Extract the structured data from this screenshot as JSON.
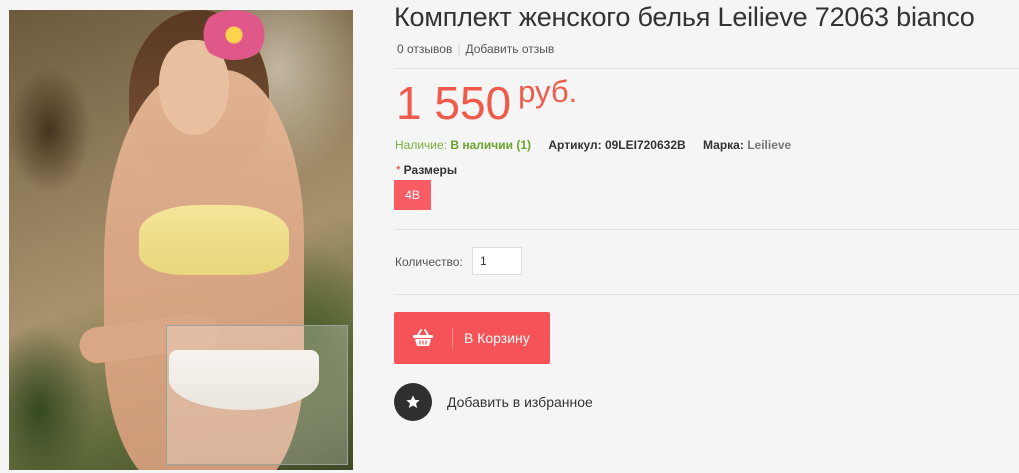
{
  "product": {
    "title": "Комплект женского белья Leilieve 72063 bianco",
    "image_alt": "product-photo"
  },
  "reviews": {
    "count_text": "0 отзывов",
    "add_text": "Добавить отзыв"
  },
  "price": {
    "amount": "1 550",
    "currency": "руб."
  },
  "meta": {
    "availability_label": "Наличие:",
    "availability_value": "В наличии (1)",
    "sku_label": "Артикул:",
    "sku_value": "09LEI720632B",
    "brand_label": "Марка:",
    "brand_value": "Leilieve"
  },
  "sizes": {
    "required_mark": "*",
    "label": "Размеры",
    "options": [
      "4B"
    ]
  },
  "quantity": {
    "label": "Количество:",
    "value": "1"
  },
  "cart": {
    "label": "В Корзину"
  },
  "wishlist": {
    "label": "Добавить в избранное"
  },
  "colors": {
    "accent": "#f55357",
    "price": "#ef5a4a",
    "in_stock": "#6aa32c"
  },
  "icons": {
    "cart": "basket-icon",
    "wishlist": "star-icon"
  }
}
